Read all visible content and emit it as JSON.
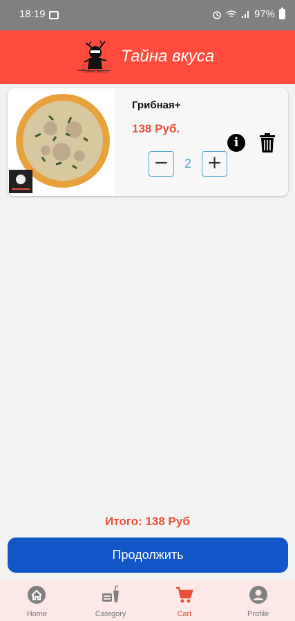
{
  "status_bar": {
    "time": "18:19",
    "battery": "97%"
  },
  "app_bar": {
    "title": "Тайна вкуса",
    "logo_caption": "Тайна вкуса"
  },
  "cart": {
    "items": [
      {
        "name": "Грибная+",
        "price": "138 Руб.",
        "quantity": "2"
      }
    ],
    "total": "Итого: 138 Руб",
    "continue_label": "Продолжить"
  },
  "bottom_nav": {
    "items": [
      {
        "label": "Home",
        "icon": "home-icon"
      },
      {
        "label": "Category",
        "icon": "category-icon"
      },
      {
        "label": "Cart",
        "icon": "cart-icon",
        "active": true
      },
      {
        "label": "Profile",
        "icon": "profile-icon"
      }
    ]
  },
  "colors": {
    "app_bar": "#ff4b3e",
    "accent": "#e8503a",
    "primary_button": "#1155c6",
    "quantity": "#4aa3c8",
    "nav_background": "#fde8e8"
  }
}
